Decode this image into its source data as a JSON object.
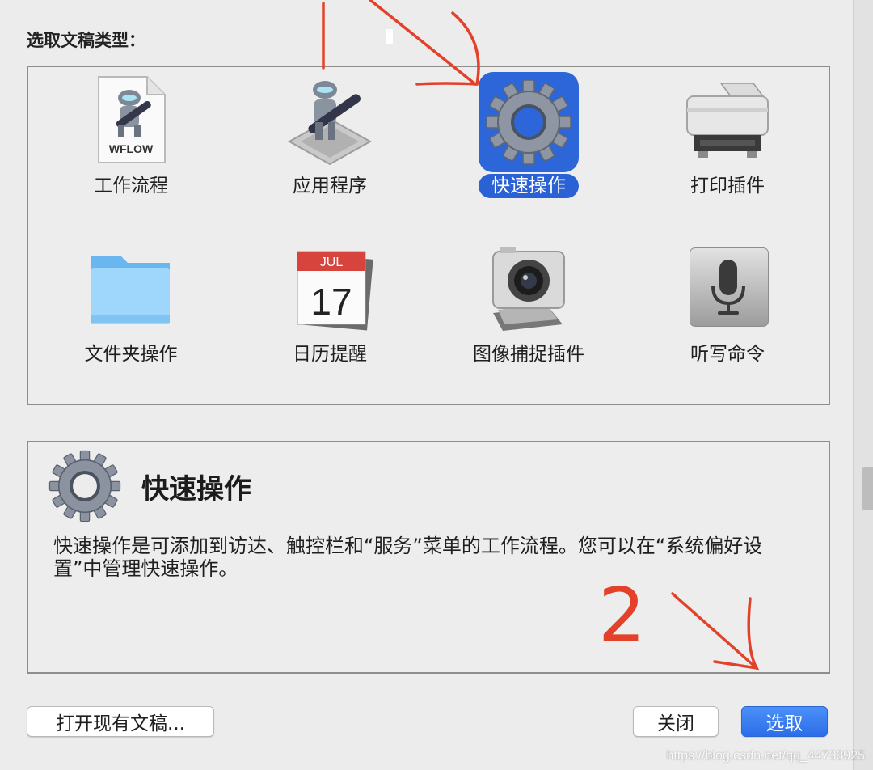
{
  "prompt": "选取文稿类型：",
  "doc_types": [
    {
      "label": "工作流程",
      "icon": "workflow-file-icon",
      "badge": "WFLOW",
      "selected": false
    },
    {
      "label": "应用程序",
      "icon": "automator-robot-icon",
      "selected": false
    },
    {
      "label": "快速操作",
      "icon": "gear-icon",
      "selected": true
    },
    {
      "label": "打印插件",
      "icon": "printer-icon",
      "selected": false
    },
    {
      "label": "文件夹操作",
      "icon": "folder-icon",
      "selected": false
    },
    {
      "label": "日历提醒",
      "icon": "calendar-icon",
      "month": "JUL",
      "day": "17",
      "selected": false
    },
    {
      "label": "图像捕捉插件",
      "icon": "camera-icon",
      "selected": false
    },
    {
      "label": "听写命令",
      "icon": "microphone-icon",
      "selected": false
    }
  ],
  "description": {
    "title": "快速操作",
    "text": "快速操作是可添加到访达、触控栏和“服务”菜单的工作流程。您可以在“系统偏好设置”中管理快速操作。"
  },
  "buttons": {
    "open_existing": "打开现有文稿...",
    "close": "关闭",
    "choose": "选取"
  },
  "annotation": {
    "number": "2",
    "color": "#e4412a"
  },
  "watermark": "https://blog.csdn.net/qq_44733925",
  "colors": {
    "selection": "#2a62d6",
    "primary_button": "#3a7ef0",
    "background": "#ececec"
  }
}
